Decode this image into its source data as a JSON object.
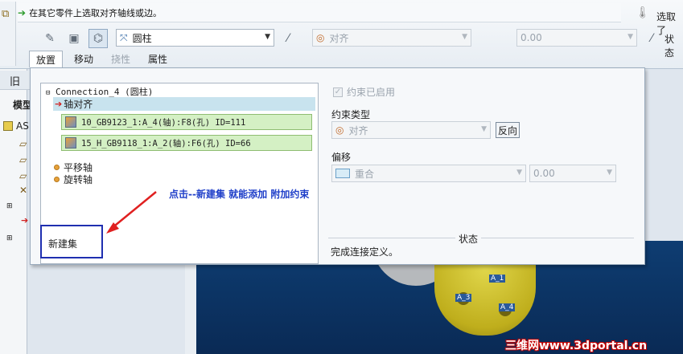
{
  "prompt": {
    "hint": "在其它零件上选取对齐轴线或边。"
  },
  "toolbar": {
    "constraint_type": "圆柱",
    "align_combo": "对齐",
    "offset_value": "0.00",
    "right_select": "选取了",
    "right_status": "状态"
  },
  "tabs": [
    {
      "label": "放置"
    },
    {
      "label": "移动"
    },
    {
      "label": "挠性"
    },
    {
      "label": "属性"
    }
  ],
  "tree": {
    "header_glyph": "旧",
    "model_label": "模型",
    "item_as": "AS"
  },
  "panel": {
    "connection_label": "Connection_4 (圆柱)",
    "axis_align_label": "轴对齐",
    "refs": [
      "10_GB9123_1:A_4(轴):F8(孔) ID=111",
      "15_H_GB9118_1:A_2(轴):F6(孔) ID=66"
    ],
    "options": [
      "平移轴",
      "旋转轴"
    ],
    "new_set": "新建集",
    "annotation": "点击--新建集 就能添加 附加约束",
    "constraint_enabled": "约束已启用",
    "constraint_type_label": "约束类型",
    "constraint_type_value": "对齐",
    "flip_button": "反向",
    "offset_label": "偏移",
    "offset_type_value": "重合",
    "offset_value": "0.00",
    "status_label": "状态",
    "status_text": "完成连接定义。"
  },
  "viewport": {
    "axis_tags": [
      "A_1",
      "A_3",
      "A_4"
    ]
  },
  "watermark": "三维网www.3dportal.cn",
  "colors": {
    "accent_blue": "#1f3fc9",
    "annotation_box": "#1f2fb0",
    "arrow_red": "#e02020",
    "ref_green": "#d4f0c4"
  }
}
